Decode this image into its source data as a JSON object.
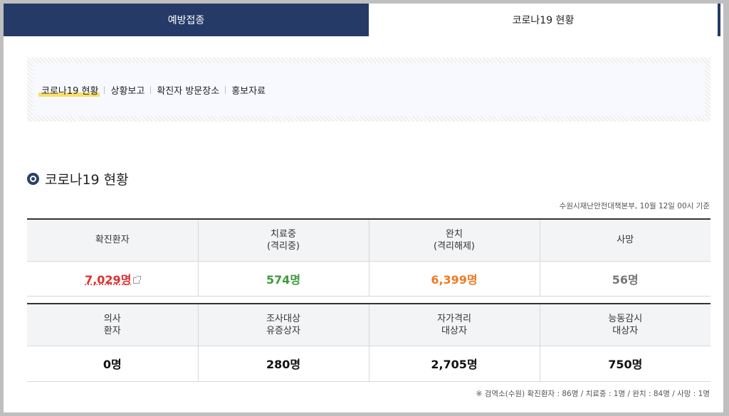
{
  "tabs": [
    {
      "label": "예방접종"
    },
    {
      "label": "코로나19 현황"
    }
  ],
  "subnav": [
    {
      "label": "코로나19 현황"
    },
    {
      "label": "상황보고"
    },
    {
      "label": "확진자 방문장소"
    },
    {
      "label": "홍보자료"
    }
  ],
  "section": {
    "title": "코로나19 현황"
  },
  "basis": "수원시재난안전대책본부, 10월 12일 00시 기준",
  "table1": {
    "headers": [
      {
        "line1": "확진환자",
        "line2": ""
      },
      {
        "line1": "치료중",
        "line2": "(격리중)"
      },
      {
        "line1": "완치",
        "line2": "(격리해제)"
      },
      {
        "line1": "사망",
        "line2": ""
      }
    ],
    "values": [
      "7,029명",
      "574명",
      "6,399명",
      "56명"
    ]
  },
  "table2": {
    "headers": [
      {
        "line1": "의사",
        "line2": "환자"
      },
      {
        "line1": "조사대상",
        "line2": "유증상자"
      },
      {
        "line1": "자가격리",
        "line2": "대상자"
      },
      {
        "line1": "능동감시",
        "line2": "대상자"
      }
    ],
    "values": [
      "0명",
      "280명",
      "2,705명",
      "750명"
    ]
  },
  "footnote": "※ 검역소(수원) 확진환자 : 86명 / 치료중 : 1명 / 완치 : 84명 / 사망 : 1명",
  "colors": {
    "tab_dark": "#253a66",
    "confirmed": "#e03131",
    "treating": "#3e9a3e",
    "recovered": "#f07a22",
    "deaths": "#777777",
    "highlight": "#f6e06a"
  }
}
